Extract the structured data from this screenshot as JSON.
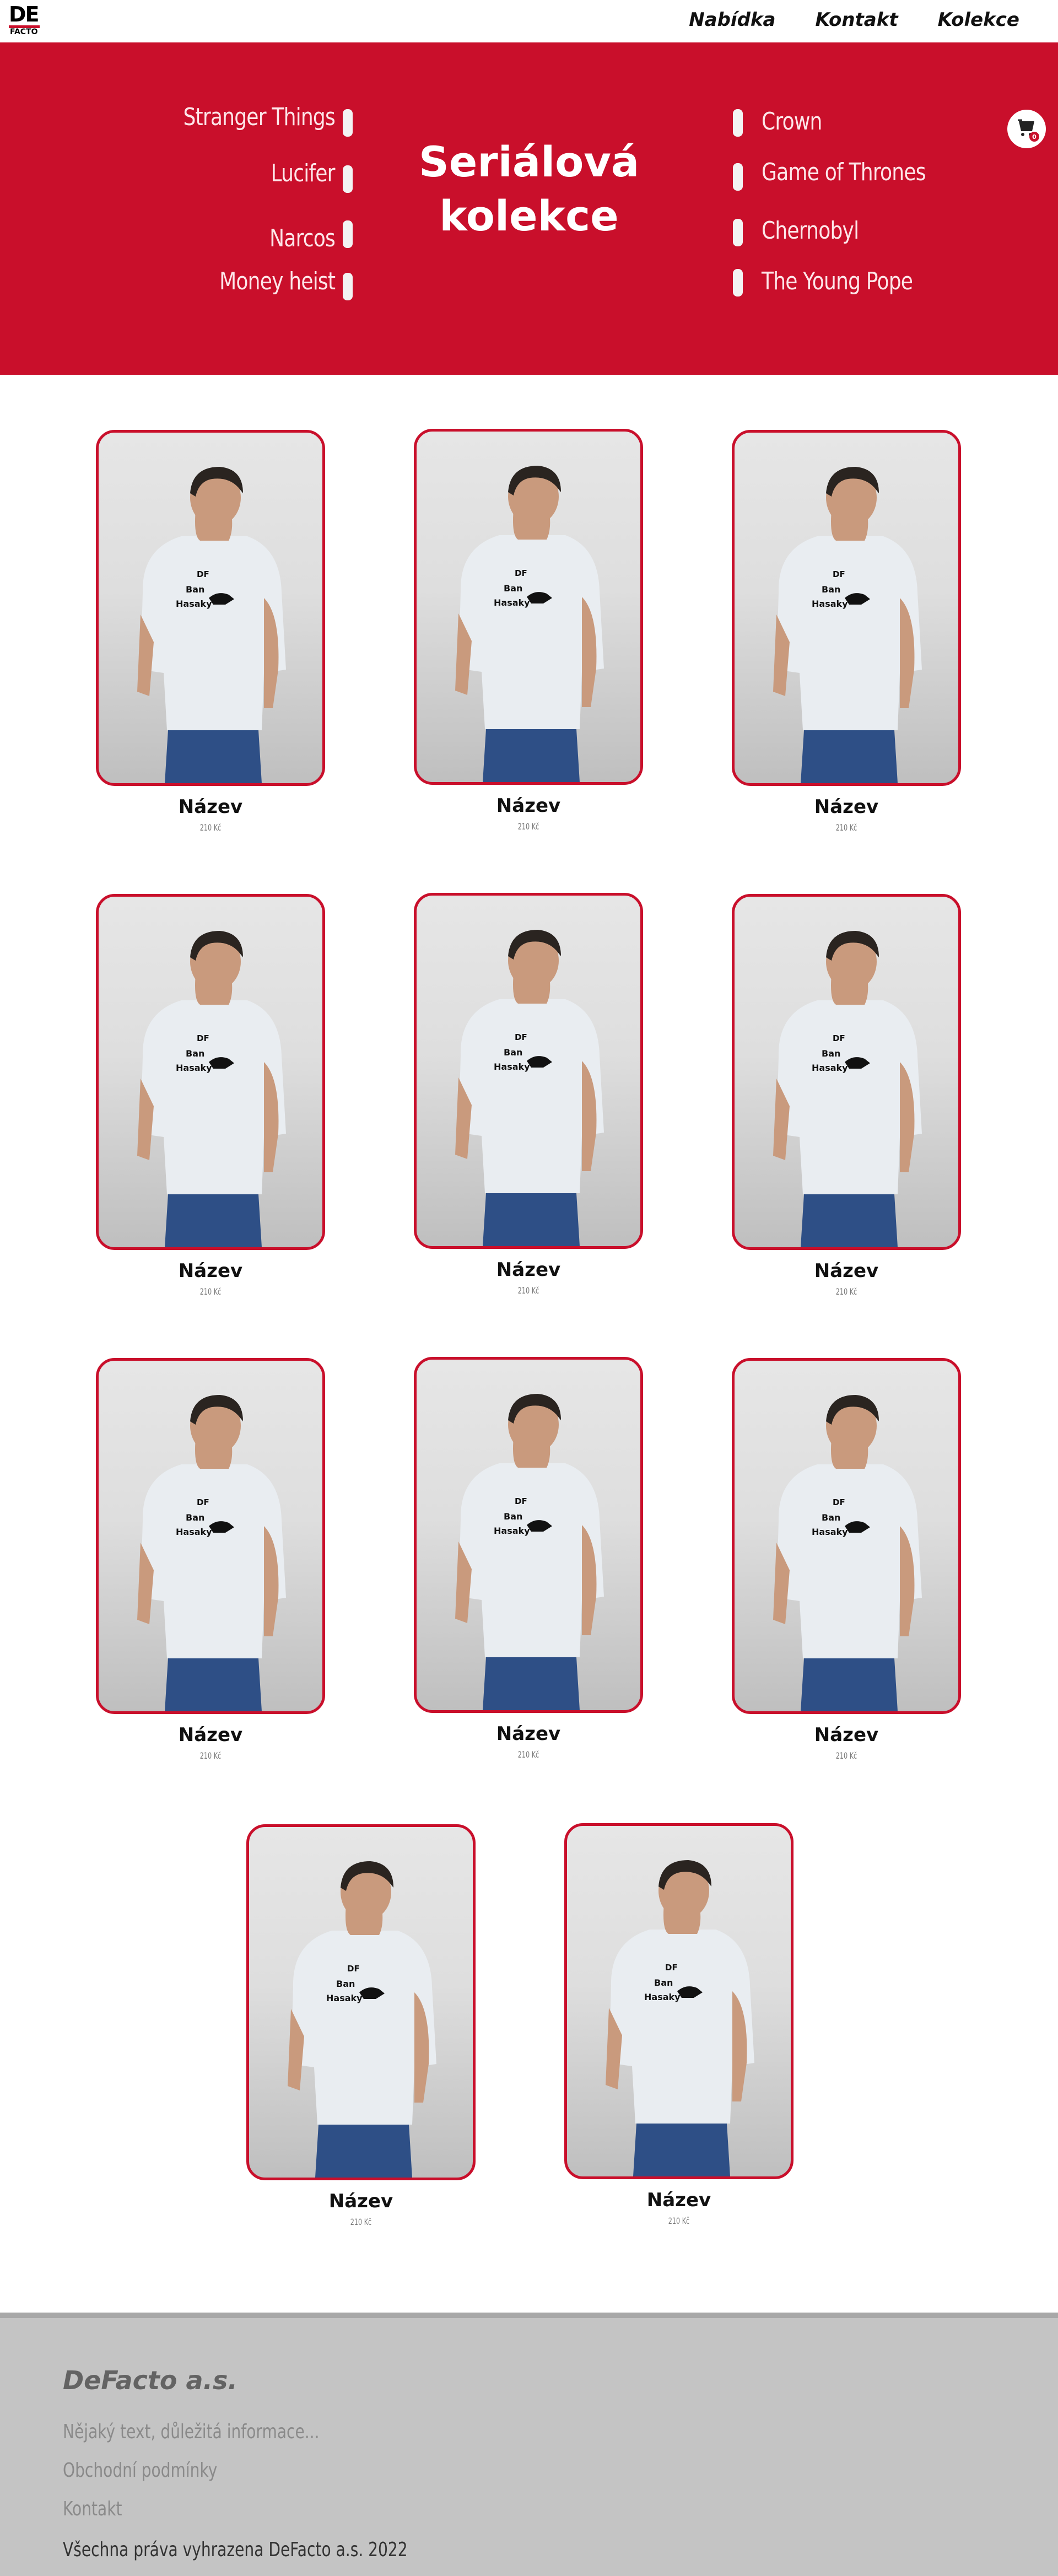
{
  "header": {
    "logo_top": "DE",
    "logo_bottom": "FACTO",
    "nav": [
      "Nabídka",
      "Kontakt",
      "Kolekce"
    ]
  },
  "hero": {
    "title_line1": "Seriálová",
    "title_line2": "kolekce",
    "left_series": [
      "Stranger Things",
      "Lucifer",
      "Narcos",
      "Money heist"
    ],
    "right_series": [
      "Crown",
      "Game of Thrones",
      "Chernobyl",
      "The Young Pope"
    ]
  },
  "products": [
    {
      "name": "Název",
      "price": "210 Kč",
      "print": [
        "DF",
        "Ban",
        "Hasaky"
      ]
    },
    {
      "name": "Název",
      "price": "210 Kč",
      "print": [
        "DF",
        "Ban",
        "Hasaky"
      ]
    },
    {
      "name": "Název",
      "price": "210 Kč",
      "print": [
        "DF",
        "Ban",
        "Hasaky"
      ]
    },
    {
      "name": "Název",
      "price": "210 Kč",
      "print": [
        "DF",
        "Ban",
        "Hasaky"
      ]
    },
    {
      "name": "Název",
      "price": "210 Kč",
      "print": [
        "DF",
        "Ban",
        "Hasaky"
      ]
    },
    {
      "name": "Název",
      "price": "210 Kč",
      "print": [
        "DF",
        "Ban",
        "Hasaky"
      ]
    },
    {
      "name": "Název",
      "price": "210 Kč",
      "print": [
        "DF",
        "Ban",
        "Hasaky"
      ]
    },
    {
      "name": "Název",
      "price": "210 Kč",
      "print": [
        "DF",
        "Ban",
        "Hasaky"
      ]
    },
    {
      "name": "Název",
      "price": "210 Kč",
      "print": [
        "DF",
        "Ban",
        "Hasaky"
      ]
    },
    {
      "name": "Název",
      "price": "210 Kč",
      "print": [
        "DF",
        "Ban",
        "Hasaky"
      ]
    },
    {
      "name": "Název",
      "price": "210 Kč",
      "print": [
        "DF",
        "Ban",
        "Hasaky"
      ]
    }
  ],
  "footer": {
    "brand": "DeFacto a.s.",
    "links": [
      "Nějaký text, důležitá informace...",
      "Obchodní podmínky",
      "Kontakt"
    ],
    "copyright": "Všechna práva vyhrazena DeFacto a.s. 2022"
  },
  "colors": {
    "accent": "#c90f2b",
    "footer_bg": "#c4c4c4"
  },
  "icons": [
    "cart-icon"
  ]
}
